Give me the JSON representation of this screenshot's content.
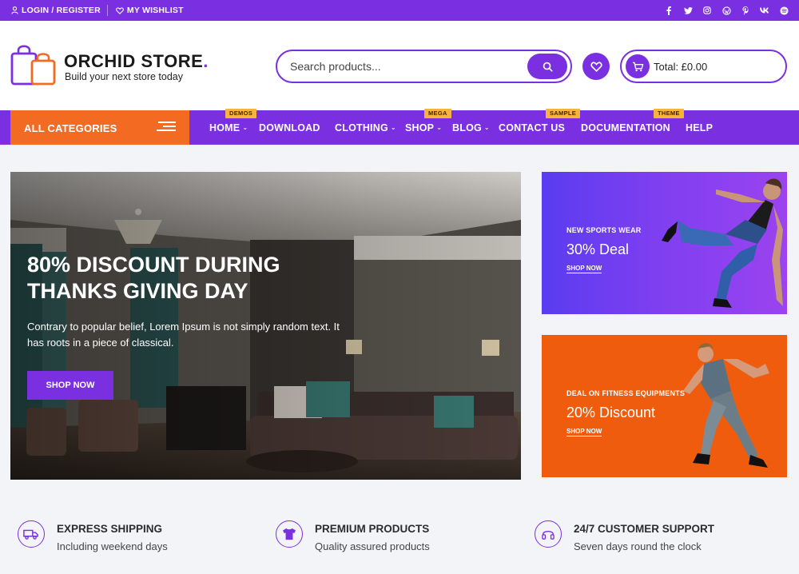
{
  "topbar": {
    "login_label": "LOGIN / REGISTER",
    "wishlist_label": "MY WISHLIST",
    "social": [
      "f",
      "t",
      "ig",
      "wp",
      "p",
      "vk",
      "sp"
    ]
  },
  "header": {
    "logo_title": "ORCHID STORE",
    "logo_dot": ".",
    "logo_tagline": "Build your next store today",
    "search_placeholder": "Search products...",
    "cart_total": "Total: £0.00"
  },
  "nav": {
    "all_categories": "ALL CATEGORIES",
    "items": [
      {
        "label": "HOME",
        "badge": "DEMOS",
        "dropdown": true
      },
      {
        "label": "DOWNLOAD",
        "badge": "",
        "dropdown": false
      },
      {
        "label": "CLOTHING",
        "badge": "",
        "dropdown": true
      },
      {
        "label": "SHOP",
        "badge": "MEGA",
        "dropdown": true
      },
      {
        "label": "BLOG",
        "badge": "",
        "dropdown": true
      },
      {
        "label": "CONTACT US",
        "badge": "SAMPLE",
        "dropdown": false
      },
      {
        "label": "DOCUMENTATION",
        "badge": "THEME",
        "dropdown": false
      },
      {
        "label": "HELP",
        "badge": "",
        "dropdown": false
      }
    ]
  },
  "hero": {
    "title": "80% DISCOUNT DURING THANKS GIVING DAY",
    "text": "Contrary to popular belief, Lorem Ipsum is not simply random text. It has roots in a piece of classical.",
    "button": "SHOP NOW"
  },
  "promos": [
    {
      "small": "NEW SPORTS WEAR",
      "big": "30% Deal",
      "link": "SHOP NOW",
      "color": "#7a3ef0"
    },
    {
      "small": "DEAL ON FITNESS EQUIPMENTS",
      "big": "20% Discount",
      "link": "SHOP NOW",
      "color": "#f05c0e"
    }
  ],
  "features": [
    {
      "title": "EXPRESS SHIPPING",
      "subtitle": "Including weekend days",
      "icon": "delivery-icon"
    },
    {
      "title": "PREMIUM PRODUCTS",
      "subtitle": "Quality assured products",
      "icon": "tshirt-icon"
    },
    {
      "title": "24/7 CUSTOMER SUPPORT",
      "subtitle": "Seven days round the clock",
      "icon": "headset-icon"
    }
  ],
  "colors": {
    "primary": "#7a2fe0",
    "accent": "#f36b23",
    "badge": "#f7b43d"
  }
}
